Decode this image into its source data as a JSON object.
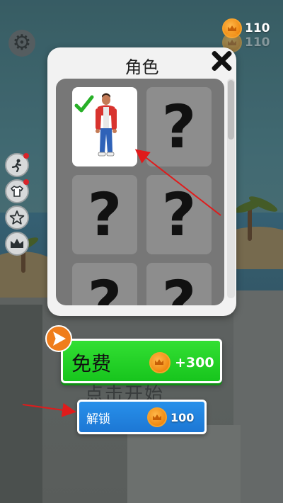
{
  "hud": {
    "coins": "110",
    "coins_ghost": "110"
  },
  "popup": {
    "title": "角色",
    "slots": [
      {
        "state": "selected",
        "label": ""
      },
      {
        "state": "locked",
        "label": "?"
      },
      {
        "state": "locked",
        "label": "?"
      },
      {
        "state": "locked",
        "label": "?"
      },
      {
        "state": "locked",
        "label": "?"
      },
      {
        "state": "locked",
        "label": "?"
      }
    ]
  },
  "buttons": {
    "free_label": "免费",
    "free_reward": "+300",
    "unlock_label": "解锁",
    "unlock_price": "100"
  },
  "background_text": "点击开始",
  "icons": {
    "settings": "gear-icon",
    "coin": "crown-coin-icon",
    "close": "close-icon",
    "check": "checkmark-icon",
    "video": "video-play-icon",
    "side": [
      "running-character-icon",
      "shirt-icon",
      "star-icon",
      "crown-icon"
    ]
  },
  "colors": {
    "free_button": "#22cf25",
    "unlock_button": "#1f80de",
    "coin": "#f08a12",
    "annotation_arrow": "#e01b1b",
    "check": "#27b027"
  }
}
